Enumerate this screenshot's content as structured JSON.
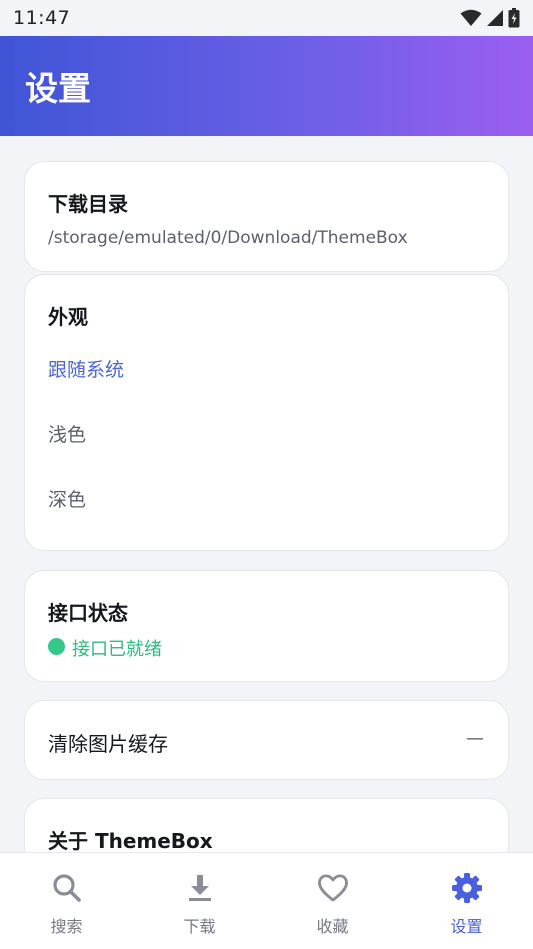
{
  "status_bar": {
    "time": "11:47"
  },
  "header": {
    "title": "设置"
  },
  "download_dir": {
    "title": "下载目录",
    "path": "/storage/emulated/0/Download/ThemeBox"
  },
  "appearance": {
    "title": "外观",
    "options": [
      "跟随系统",
      "浅色",
      "深色"
    ],
    "selected": "跟随系统"
  },
  "api_status": {
    "title": "接口状态",
    "status_text": "接口已就绪",
    "status_color": "#33c98d"
  },
  "cache": {
    "label": "清除图片缓存",
    "value": "—"
  },
  "about": {
    "title": "关于 ThemeBox"
  },
  "bottom_nav": {
    "items": [
      {
        "label": "搜索",
        "icon": "search-icon"
      },
      {
        "label": "下载",
        "icon": "download-icon"
      },
      {
        "label": "收藏",
        "icon": "heart-icon"
      },
      {
        "label": "设置",
        "icon": "gear-icon"
      }
    ],
    "active": "设置"
  },
  "colors": {
    "accent": "#4a5fe0",
    "header_gradient_start": "#3f55d6",
    "header_gradient_end": "#9b5ff0"
  }
}
